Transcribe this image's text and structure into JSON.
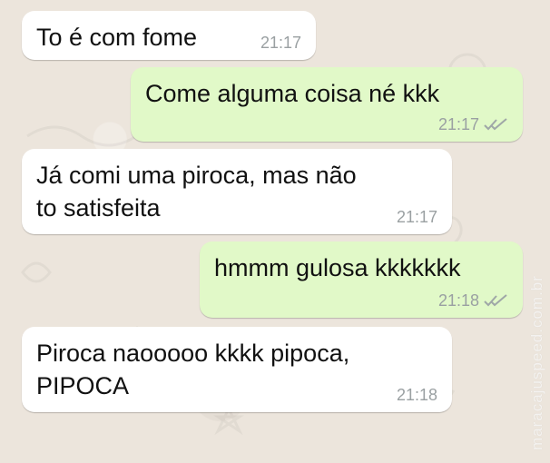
{
  "conversation": {
    "messages": [
      {
        "direction": "incoming",
        "text": "To é com fome",
        "time": "21:17"
      },
      {
        "direction": "outgoing",
        "text": "Come alguma coisa né kkk",
        "time": "21:17",
        "status_icon": "double-check-icon"
      },
      {
        "direction": "incoming",
        "text": "Já comi uma piroca, mas não\nto satisfeita",
        "time": "21:17"
      },
      {
        "direction": "outgoing",
        "text": "hmmm gulosa kkkkkkk",
        "time": "21:18",
        "status_icon": "double-check-icon"
      },
      {
        "direction": "incoming",
        "text": "Piroca naooooo kkkk pipoca,\nPIPOCA",
        "time": "21:18"
      }
    ]
  },
  "watermark": {
    "text": "maracajuspeed.com.br"
  },
  "colors": {
    "background": "#ece5dc",
    "incoming_bubble": "#ffffff",
    "outgoing_bubble": "#e1f9c8",
    "timestamp": "#9aa0a2",
    "ticks": "#9fa7a7"
  }
}
